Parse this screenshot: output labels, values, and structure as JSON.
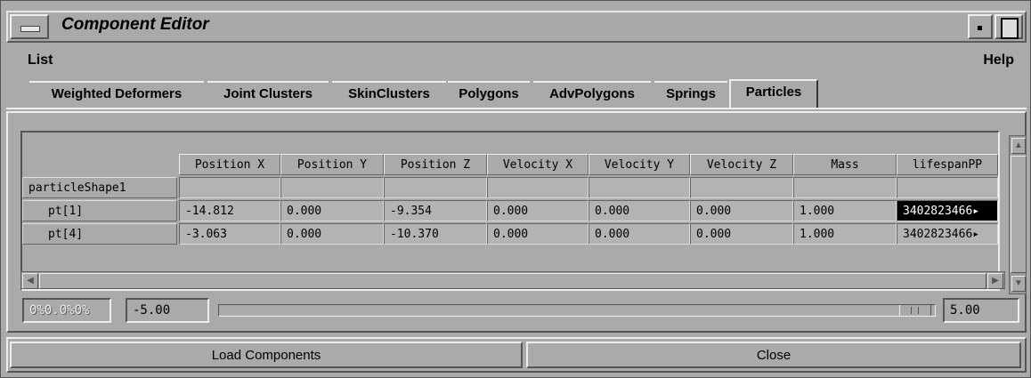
{
  "window": {
    "title": "Component Editor"
  },
  "menubar": {
    "list": "List",
    "help": "Help"
  },
  "tabs": [
    "Weighted Deformers",
    "Joint Clusters",
    "SkinClusters",
    "Polygons",
    "AdvPolygons",
    "Springs",
    "Particles"
  ],
  "active_tab": "Particles",
  "table": {
    "columns": [
      "Position X",
      "Position Y",
      "Position Z",
      "Velocity X",
      "Velocity Y",
      "Velocity Z",
      "Mass",
      "lifespanPP"
    ],
    "group": "particleShape1",
    "rows": [
      {
        "label": "pt[1]",
        "values": [
          "-14.812",
          "0.000",
          "-9.354",
          "0.000",
          "0.000",
          "0.000",
          "1.000",
          "3402823466▸"
        ]
      },
      {
        "label": "pt[4]",
        "values": [
          "-3.063",
          "0.000",
          "-10.370",
          "0.000",
          "0.000",
          "0.000",
          "1.000",
          "3402823466▸"
        ]
      }
    ]
  },
  "slider": {
    "readout": "0%0.0%0%",
    "min": "-5.00",
    "max": "5.00"
  },
  "buttons": {
    "load": "Load Components",
    "close": "Close"
  }
}
